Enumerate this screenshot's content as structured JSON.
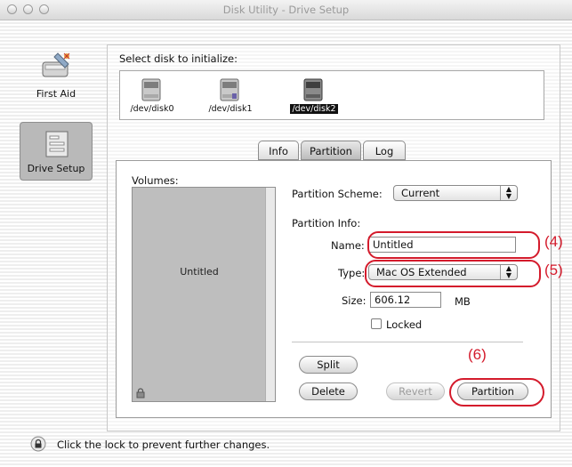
{
  "window": {
    "title": "Disk Utility - Drive Setup"
  },
  "sidebar": {
    "items": [
      {
        "label": "First Aid",
        "icon": "first-aid-icon",
        "selected": false
      },
      {
        "label": "Drive Setup",
        "icon": "drive-setup-icon",
        "selected": true
      }
    ]
  },
  "disk_select": {
    "prompt": "Select disk to initialize:",
    "disks": [
      {
        "label": "/dev/disk0",
        "selected": false
      },
      {
        "label": "/dev/disk1",
        "selected": false
      },
      {
        "label": "/dev/disk2",
        "selected": true
      }
    ]
  },
  "tabs": [
    {
      "label": "Info",
      "active": false
    },
    {
      "label": "Partition",
      "active": true
    },
    {
      "label": "Log",
      "active": false
    }
  ],
  "partition": {
    "volumes_label": "Volumes:",
    "volume_name": "Untitled",
    "scheme_label": "Partition Scheme:",
    "scheme_value": "Current",
    "info_label": "Partition Info:",
    "name_label": "Name:",
    "name_value": "Untitled",
    "type_label": "Type:",
    "type_value": "Mac OS Extended",
    "size_label": "Size:",
    "size_value": "606.12",
    "size_unit": "MB",
    "locked_label": "Locked",
    "locked_checked": false
  },
  "buttons": {
    "split": "Split",
    "delete": "Delete",
    "revert": "Revert",
    "partition": "Partition"
  },
  "footer": {
    "lock_text": "Click the lock to prevent further changes."
  },
  "annotations": {
    "name": "(4)",
    "type": "(5)",
    "partition": "(6)"
  },
  "colors": {
    "annotation": "#d41b2c",
    "selection": "#111111"
  }
}
